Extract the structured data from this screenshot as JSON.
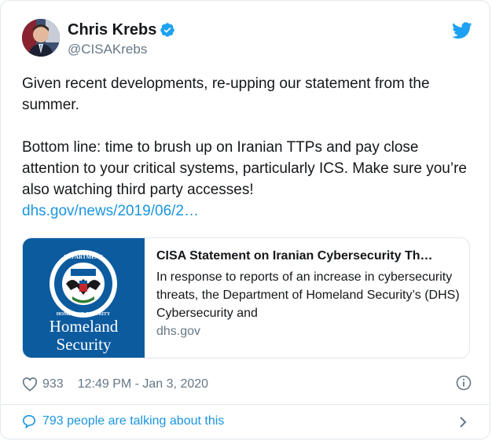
{
  "author": {
    "name": "Chris Krebs",
    "handle": "@CISAKrebs",
    "verified": true
  },
  "tweet": {
    "paragraph1": "Given recent developments, re-upping our statement from the summer.",
    "paragraph2": "Bottom line: time to brush up on Iranian TTPs and pay close attention to your critical systems, particularly ICS. Make sure you’re also watching third party accesses!",
    "link_text": "dhs.gov/news/2019/06/2…"
  },
  "link_card": {
    "thumbnail_line1": "Homeland",
    "thumbnail_line2": "Security",
    "title": "CISA Statement on Iranian Cybersecurity Th…",
    "description": "In response to reports of an increase in cybersecurity threats, the Department of Homeland Security’s (DHS) Cybersecurity and",
    "domain": "dhs.gov"
  },
  "meta": {
    "likes": "933",
    "timestamp": "12:49 PM - Jan 3, 2020"
  },
  "footer": {
    "talking_text": "793 people are talking about this"
  },
  "colors": {
    "accent": "#1b95e0",
    "muted": "#657786",
    "border": "#e1e8ed",
    "dhs_blue": "#0c5b9f"
  },
  "icons": [
    "verified-badge-icon",
    "twitter-bird-icon",
    "heart-icon",
    "info-icon",
    "speech-bubble-icon",
    "chevron-right-icon"
  ]
}
